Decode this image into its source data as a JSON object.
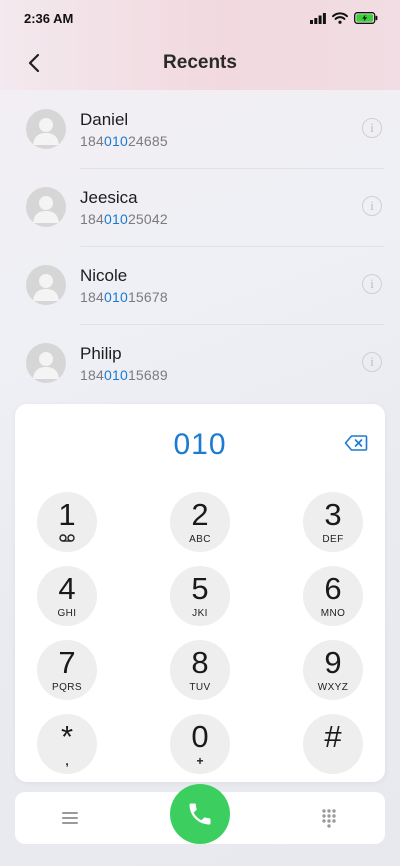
{
  "status_bar": {
    "time": "2:36 AM"
  },
  "header": {
    "title": "Recents"
  },
  "contacts": [
    {
      "name": "Daniel",
      "number_prefix": "184",
      "number_match": "010",
      "number_suffix": "24685"
    },
    {
      "name": "Jeesica",
      "number_prefix": "184",
      "number_match": "010",
      "number_suffix": "25042"
    },
    {
      "name": "Nicole",
      "number_prefix": "184",
      "number_match": "010",
      "number_suffix": "15678"
    },
    {
      "name": "Philip",
      "number_prefix": "184",
      "number_match": "010",
      "number_suffix": "15689"
    }
  ],
  "dialpad": {
    "dialed_number": "010",
    "keys": [
      {
        "digit": "1",
        "letters": ""
      },
      {
        "digit": "2",
        "letters": "ABC"
      },
      {
        "digit": "3",
        "letters": "DEF"
      },
      {
        "digit": "4",
        "letters": "GHI"
      },
      {
        "digit": "5",
        "letters": "JKI"
      },
      {
        "digit": "6",
        "letters": "MNO"
      },
      {
        "digit": "7",
        "letters": "PQRS"
      },
      {
        "digit": "8",
        "letters": "TUV"
      },
      {
        "digit": "9",
        "letters": "WXYZ"
      },
      {
        "digit": "*",
        "letters": ","
      },
      {
        "digit": "0",
        "letters": "+"
      },
      {
        "digit": "#",
        "letters": ""
      }
    ]
  },
  "colors": {
    "accent": "#1b7ad1",
    "call": "#3ccf60",
    "battery": "#3ccf3c"
  },
  "icons": {
    "back": "back-arrow-icon",
    "info": "info-icon",
    "backspace": "backspace-icon",
    "voicemail": "voicemail-icon",
    "menu": "menu-icon",
    "call": "phone-icon",
    "keypad": "keypad-grid-icon"
  }
}
